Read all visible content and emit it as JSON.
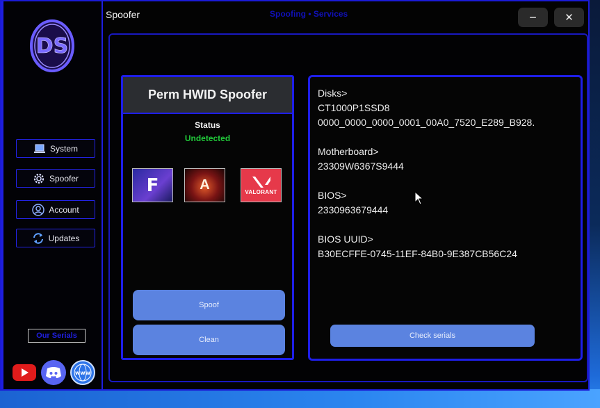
{
  "window": {
    "title": "Spoofer",
    "center_title": "Spoofing • Services",
    "minimize_label": "−",
    "close_label": "✕"
  },
  "logo": {
    "text": "DS"
  },
  "sidebar": {
    "items": [
      {
        "label": "System",
        "icon": "laptop-icon"
      },
      {
        "label": "Spoofer",
        "icon": "gear-icon"
      },
      {
        "label": "Account",
        "icon": "user-circle-icon"
      },
      {
        "label": "Updates",
        "icon": "refresh-icon"
      }
    ],
    "our_serials_label": "Our Serials",
    "social": [
      "youtube-icon",
      "discord-icon",
      "www-globe-icon"
    ],
    "social_text": {
      "www": "www"
    }
  },
  "spoofer_panel": {
    "title": "Perm HWID Spoofer",
    "status_label": "Status",
    "status_value": "Undetected",
    "games": [
      {
        "name": "fortnite-icon",
        "letter": "F"
      },
      {
        "name": "apex-legends-icon",
        "letter": "A"
      },
      {
        "name": "valorant-icon",
        "letter": "VALORANT"
      }
    ],
    "spoof_label": "Spoof",
    "clean_label": "Clean"
  },
  "serials_panel": {
    "disks_label": "Disks>",
    "disks_model": "CT1000P1SSD8",
    "disks_serial": "0000_0000_0000_0001_00A0_7520_E289_B928.",
    "motherboard_label": "Motherboard>",
    "motherboard_serial": "23309W6367S9444",
    "bios_label": "BIOS>",
    "bios_serial": "2330963679444",
    "bios_uuid_label": "BIOS UUID>",
    "bios_uuid": "B30ECFFE-0745-11EF-84B0-9E387CB56C24",
    "check_label": "Check serials"
  },
  "colors": {
    "accent_border": "#1e1ee8",
    "button_fill": "#5b83e0",
    "status_green": "#21c93a"
  }
}
